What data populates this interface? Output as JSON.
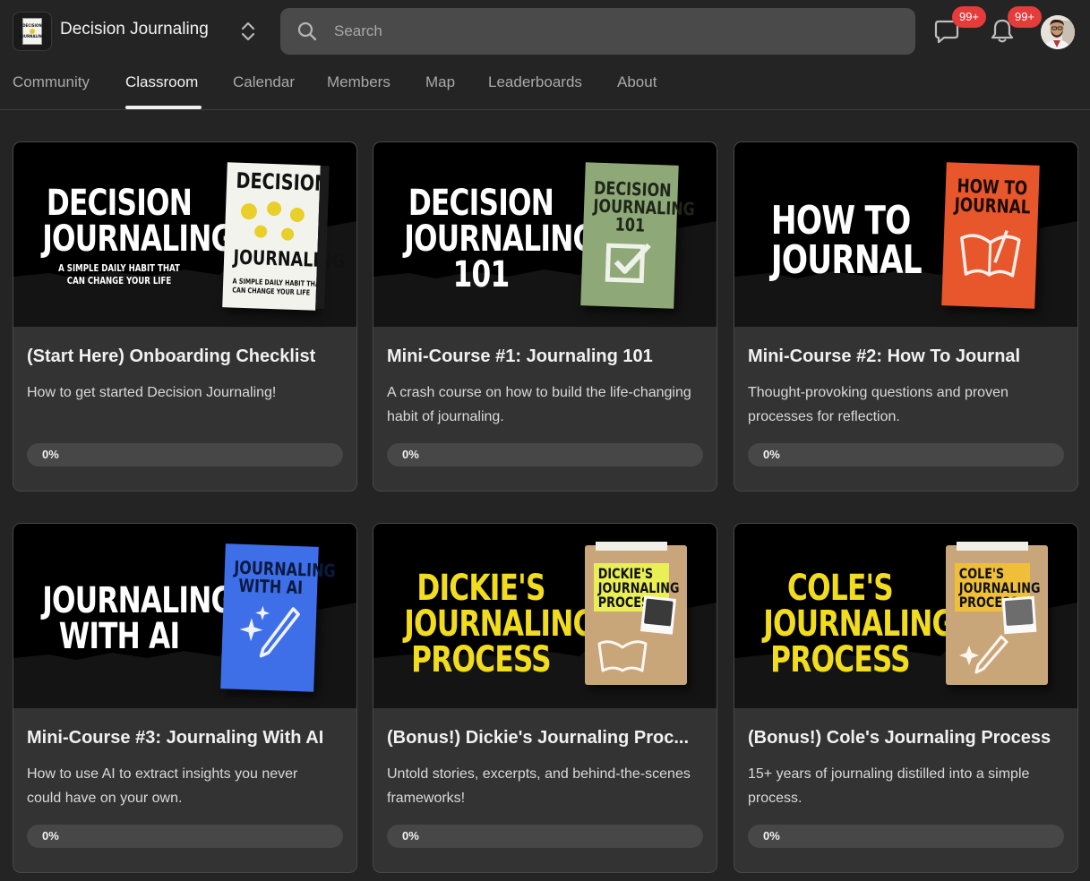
{
  "header": {
    "group_name": "Decision Journaling",
    "search_placeholder": "Search",
    "chat_badge": "99+",
    "notification_badge": "99+",
    "logo_text": "DECISION JOURNALING"
  },
  "tabs": [
    {
      "label": "Community",
      "active": false
    },
    {
      "label": "Classroom",
      "active": true
    },
    {
      "label": "Calendar",
      "active": false
    },
    {
      "label": "Members",
      "active": false
    },
    {
      "label": "Map",
      "active": false
    },
    {
      "label": "Leaderboards",
      "active": false
    },
    {
      "label": "About",
      "active": false
    }
  ],
  "courses": [
    {
      "title": "(Start Here) Onboarding Checklist",
      "description": "How to get started Decision Journaling!",
      "progress_percent": 0,
      "progress_label": "0%",
      "cover": {
        "headline": "DECISION\nJOURNALING",
        "subline": "A SIMPLE DAILY HABIT THAT\nCAN CHANGE YOUR LIFE",
        "book_title": "DECISION\n\n\nJOURNALING",
        "book_sub": "A SIMPLE DAILY HABIT THAT\nCAN CHANGE YOUR LIFE",
        "book_spine": "DECISION JOURNALING",
        "book_color": "#f3f3ee",
        "headline_color": "#ffffff"
      }
    },
    {
      "title": "Mini-Course #1: Journaling 101",
      "description": "A crash course on how to build the life-changing habit of journaling.",
      "progress_percent": 0,
      "progress_label": "0%",
      "cover": {
        "headline": "DECISION\nJOURNALING\n101",
        "book_title": "DECISION\nJOURNALING\n101",
        "book_color": "#8fa878",
        "headline_color": "#ffffff"
      }
    },
    {
      "title": "Mini-Course #2: How To Journal",
      "description": "Thought-provoking questions and proven processes for reflection.",
      "progress_percent": 0,
      "progress_label": "0%",
      "cover": {
        "headline": "HOW TO\nJOURNAL",
        "book_title": "HOW TO\nJOURNAL",
        "book_color": "#e8562c",
        "headline_color": "#ffffff"
      }
    },
    {
      "title": "Mini-Course #3: Journaling With AI",
      "description": "How to use AI to extract insights you never could have on your own.",
      "progress_percent": 0,
      "progress_label": "0%",
      "cover": {
        "headline": "JOURNALING\nWITH AI",
        "book_title": "JOURNALING\nWITH AI",
        "book_color": "#3f6fe8",
        "headline_color": "#ffffff"
      }
    },
    {
      "title": "(Bonus!) Dickie's Journaling Proc...",
      "description": "Untold stories, excerpts, and behind-the-scenes frameworks!",
      "progress_percent": 0,
      "progress_label": "0%",
      "cover": {
        "headline": "DICKIE'S\nJOURNALING\nPROCESS",
        "book_title": "DICKIE'S\nJOURNALING\nPROCESS",
        "book_color": "#c9a57a",
        "headline_color": "#f2dc1e"
      }
    },
    {
      "title": "(Bonus!) Cole's Journaling Process",
      "description": "15+ years of journaling distilled into a simple process.",
      "progress_percent": 0,
      "progress_label": "0%",
      "cover": {
        "headline": "COLE'S\nJOURNALING\nPROCESS",
        "book_title": "COLE'S\nJOURNALING\nPROCESS",
        "book_color": "#c9a57a",
        "headline_color": "#f2dc1e"
      }
    }
  ]
}
